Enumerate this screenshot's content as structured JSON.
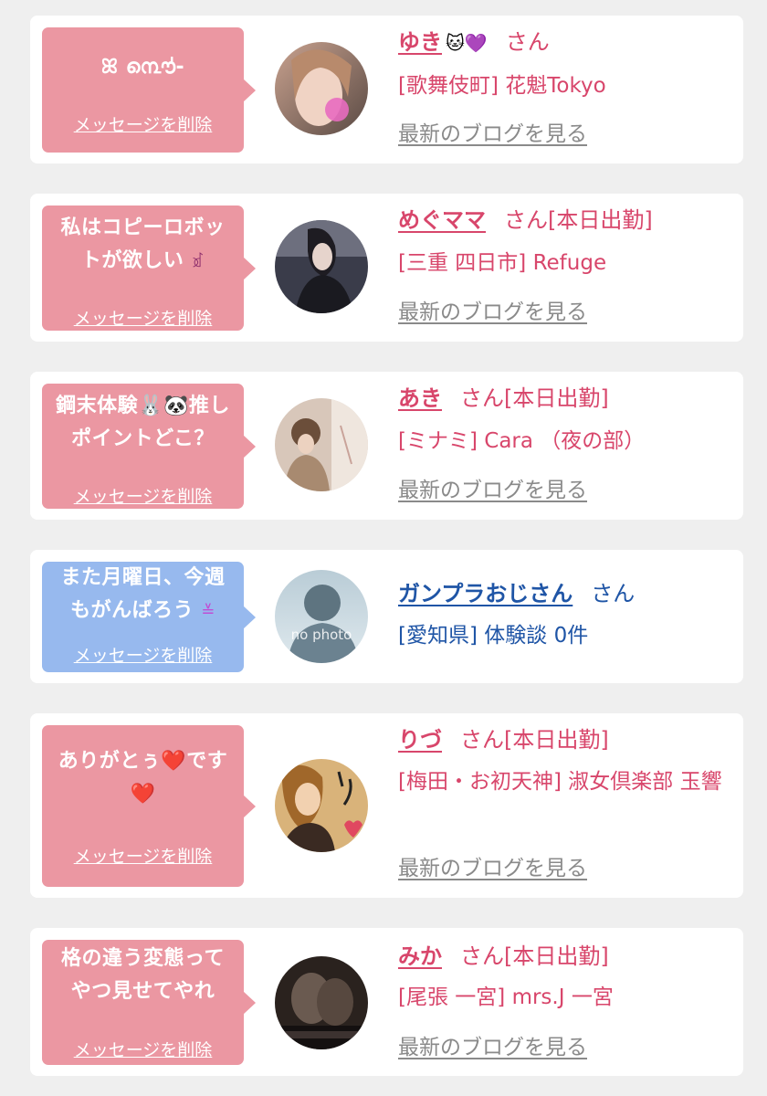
{
  "messages": [
    {
      "bubble_lines": [
        "ꕤ ൩ൌ̍-"
      ],
      "bubble_color": "pink",
      "delete_label": "メッセージを削除",
      "name": "ゆき",
      "name_emoji": "🐱💜",
      "suffix": "さん",
      "shop": "[歌舞伎町] 花魁Tokyo",
      "blog_label": "最新のブログを見る",
      "avatar_icon": "avatar-photo"
    },
    {
      "bubble_lines": [
        "私はコピーロボッ",
        "トが欲しい"
      ],
      "bubble_emoji": "ꀃ",
      "bubble_color": "pink",
      "delete_label": "メッセージを削除",
      "name": "めぐママ",
      "suffix": "さん[本日出勤]",
      "shop": "[三重 四日市] Refuge",
      "blog_label": "最新のブログを見る",
      "avatar_icon": "avatar-photo"
    },
    {
      "bubble_lines": [
        "鋼末体験🐰🐼推し",
        "ポイントどこ？"
      ],
      "bubble_color": "pink",
      "delete_label": "メッセージを削除",
      "name": "あき",
      "suffix": "さん[本日出勤]",
      "shop": "[ミナミ] Cara （夜の部）",
      "blog_label": "最新のブログを見る",
      "avatar_icon": "avatar-photo"
    },
    {
      "bubble_lines": [
        "また月曜日、今週",
        "もがんばろう"
      ],
      "bubble_emoji": "≚",
      "bubble_color": "blue",
      "delete_label": "メッセージを削除",
      "name": "ガンプラおじさん",
      "suffix": "さん",
      "shop": "[愛知県] 体験談 0件",
      "avatar_icon": "no-photo-avatar",
      "avatar_text": "no photo"
    },
    {
      "bubble_lines": [
        "ありがとぅ❤️です",
        "❤️"
      ],
      "bubble_color": "pink",
      "delete_label": "メッセージを削除",
      "name": "りづ",
      "suffix": "さん[本日出勤]",
      "shop": "[梅田・お初天神] 淑女倶楽部 玉響",
      "blog_label": "最新のブログを見る",
      "avatar_icon": "avatar-photo"
    },
    {
      "bubble_lines": [
        "格の違う変態って",
        "やつ見せてやれ"
      ],
      "bubble_color": "pink",
      "delete_label": "メッセージを削除",
      "name": "みか",
      "suffix": "さん[本日出勤]",
      "shop": "[尾張 一宮] mrs.J 一宮",
      "blog_label": "最新のブログを見る",
      "avatar_icon": "avatar-photo"
    }
  ],
  "colors": {
    "page_bg": "#efefef",
    "card_bg": "#ffffff",
    "bubble_pink": "#eb97a2",
    "bubble_blue": "#97b9ee",
    "name_pink": "#d8466b",
    "name_blue": "#1f55a6",
    "blog_gray": "#8a8a8a"
  }
}
